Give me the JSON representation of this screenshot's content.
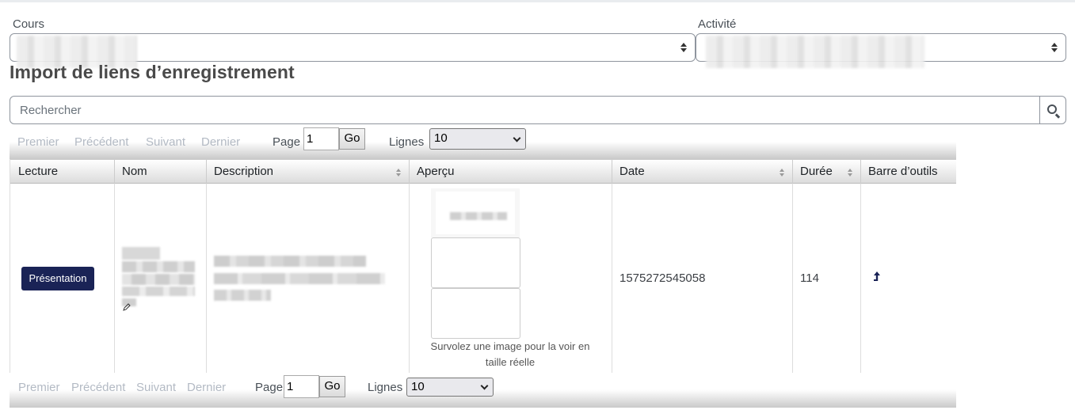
{
  "filters": {
    "course_label": "Cours",
    "activity_label": "Activité"
  },
  "page_title": "Import de liens d’enregistrement",
  "search": {
    "placeholder": "Rechercher"
  },
  "pager": {
    "first": "Premier",
    "previous": "Précédent",
    "next": "Suivant",
    "last": "Dernier",
    "page_label": "Page",
    "page_value": "1",
    "go_label": "Go",
    "lines_label": "Lignes",
    "lines_value": "10"
  },
  "table": {
    "columns": [
      "Lecture",
      "Nom",
      "Description",
      "Aperçu",
      "Date",
      "Durée",
      "Barre d’outils"
    ],
    "rows": [
      {
        "play_button": "Présentation",
        "preview_hint": "Survolez une image pour la voir en taille réelle",
        "date": "1575272545058",
        "duration": "114",
        "toolbar_icon": "import-arrow-icon"
      }
    ]
  }
}
